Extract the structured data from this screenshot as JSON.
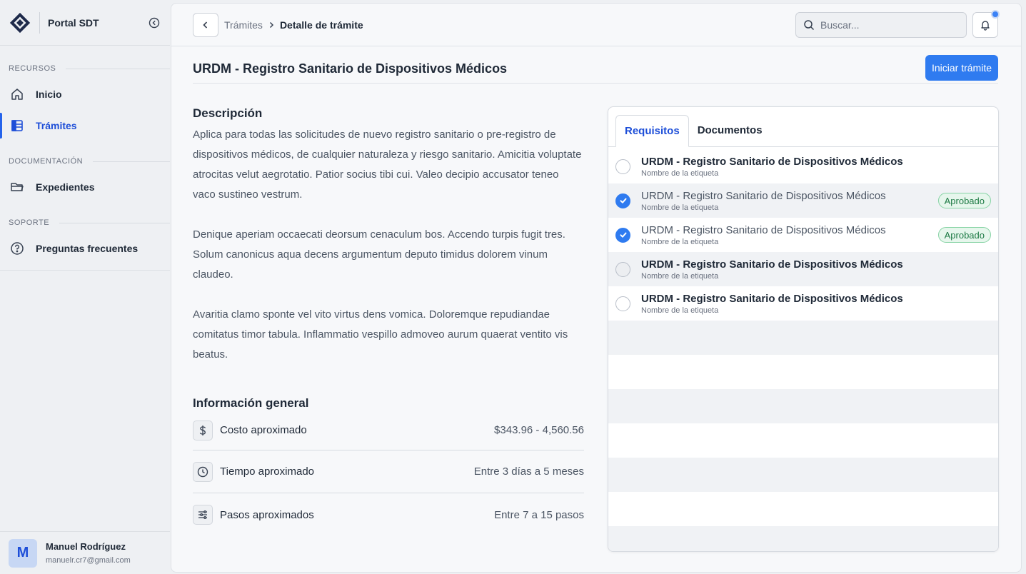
{
  "app": {
    "name": "Portal SDT"
  },
  "sidebar": {
    "sections": [
      {
        "title": "RECURSOS",
        "items": [
          {
            "label": "Inicio",
            "icon": "home-icon"
          },
          {
            "label": "Trámites",
            "icon": "tramites-icon",
            "active": true
          }
        ]
      },
      {
        "title": "DOCUMENTACIÓN",
        "items": [
          {
            "label": "Expedientes",
            "icon": "folder-icon"
          }
        ]
      },
      {
        "title": "SOPORTE",
        "items": [
          {
            "label": "Preguntas frecuentes",
            "icon": "question-icon"
          }
        ]
      }
    ]
  },
  "user": {
    "initial": "M",
    "name": "Manuel Rodríguez",
    "email": "manuelr.cr7@gmail.com"
  },
  "topbar": {
    "breadcrumb": {
      "parent": "Trámites",
      "current": "Detalle de trámite"
    },
    "search": {
      "placeholder": "Buscar...",
      "value": ""
    },
    "notification_dot": true
  },
  "page": {
    "title": "URDM - Registro Sanitario de Dispositivos Médicos",
    "primary_action": "Iniciar trámite"
  },
  "description": {
    "heading": "Descripción",
    "paragraphs": [
      "Aplica para todas las solicitudes de nuevo registro sanitario o pre-registro de dispositivos médicos, de cualquier naturaleza y riesgo sanitario. Amicitia voluptate atrocitas velut aegrotatio. Patior socius tibi cui. Valeo decipio accusator teneo vaco sustineo vestrum.",
      "Denique aperiam occaecati deorsum cenaculum bos. Accendo turpis fugit tres. Solum canonicus aqua decens argumentum deputo timidus dolorem vinum claudeo.",
      "Avaritia clamo sponte vel vito virtus dens vomica. Doloremque repudiandae comitatus timor tabula. Inflammatio vespillo admoveo aurum quaerat ventito vis beatus."
    ]
  },
  "info": {
    "heading": "Información general",
    "rows": [
      {
        "label": "Costo aproximado",
        "value": "$343.96 - 4,560.56",
        "icon": "dollar-icon"
      },
      {
        "label": "Tiempo aproximado",
        "value": "Entre 3 días a 5 meses",
        "icon": "clock-icon"
      },
      {
        "label": "Pasos aproximados",
        "value": "Entre 7 a 15 pasos",
        "icon": "steps-icon"
      }
    ]
  },
  "tabs": [
    {
      "label": "Requisitos",
      "active": true
    },
    {
      "label": "Documentos",
      "active": false
    }
  ],
  "requirements": [
    {
      "title": "URDM - Registro Sanitario de Dispositivos Médicos",
      "subtitle": "Nombre de la etiqueta",
      "checked": false,
      "badge": ""
    },
    {
      "title": "URDM - Registro Sanitario de Dispositivos Médicos",
      "subtitle": "Nombre de la etiqueta",
      "checked": true,
      "badge": "Aprobado"
    },
    {
      "title": "URDM - Registro Sanitario de Dispositivos Médicos",
      "subtitle": "Nombre de la etiqueta",
      "checked": true,
      "badge": "Aprobado"
    },
    {
      "title": "URDM - Registro Sanitario de Dispositivos Médicos",
      "subtitle": "Nombre de la etiqueta",
      "checked": false,
      "badge": ""
    },
    {
      "title": "URDM - Registro Sanitario de Dispositivos Médicos",
      "subtitle": "Nombre de la etiqueta",
      "checked": false,
      "badge": ""
    }
  ],
  "colors": {
    "accent": "#2f7bf0",
    "active_nav": "#1d4ed8",
    "badge_bg": "#e6f6ec",
    "badge_text": "#1e7a45"
  }
}
